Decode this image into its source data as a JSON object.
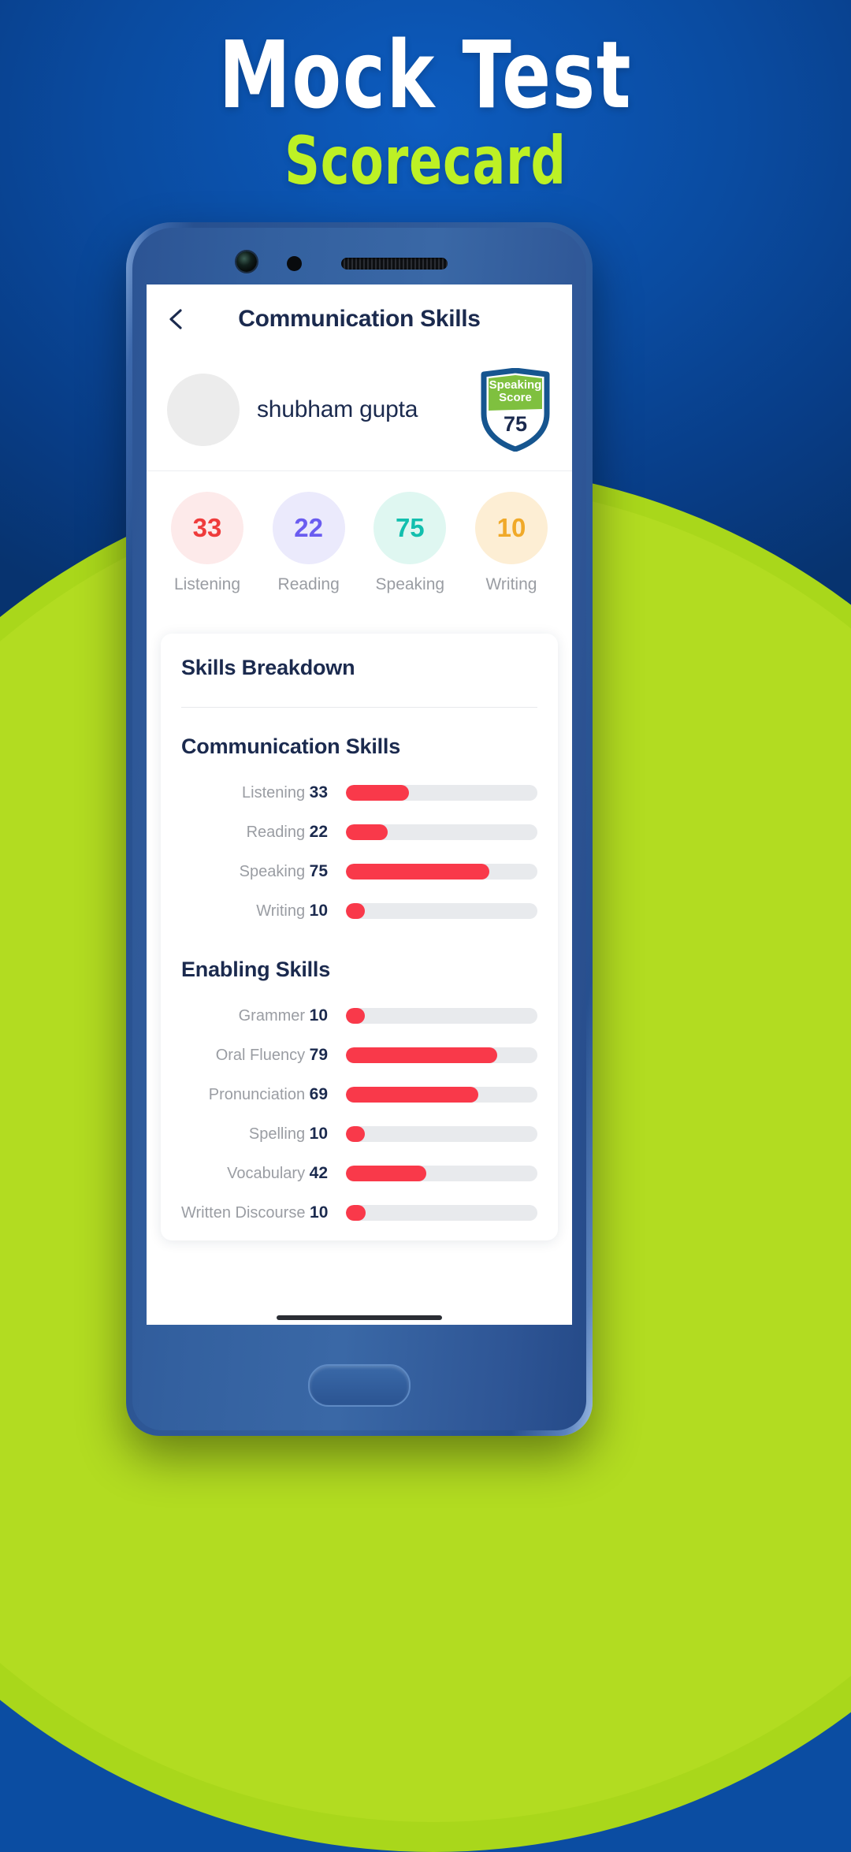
{
  "poster": {
    "title": "Mock Test",
    "subtitle": "Scorecard",
    "title_color": "#ffffff",
    "subtitle_color": "#bdf125",
    "bg_color": "#0a4ba0",
    "accent_green": "#b2dc21"
  },
  "appbar": {
    "back_icon": "chevron-left-icon",
    "title": "Communication Skills"
  },
  "profile": {
    "name": "shubham gupta",
    "avatar": "avatar-placeholder",
    "badge": {
      "label_line1": "Speaking",
      "label_line2": "Score",
      "score": "75",
      "shield_border": "#16558f",
      "shield_top": "#7fc03f",
      "shield_bottom": "#ffffff"
    }
  },
  "score_circles": [
    {
      "value": "33",
      "label": "Listening",
      "bg": "#fdeaea",
      "fg": "#ef3b3b"
    },
    {
      "value": "22",
      "label": "Reading",
      "bg": "#ebeafc",
      "fg": "#6a5cf0"
    },
    {
      "value": "75",
      "label": "Speaking",
      "bg": "#dff7f1",
      "fg": "#12bfae"
    },
    {
      "value": "10",
      "label": "Writing",
      "bg": "#fdeed4",
      "fg": "#f0a929"
    }
  ],
  "breakdown": {
    "card_title": "Skills Breakdown",
    "bar_color": "#f9394a",
    "track_color": "#e8eaed",
    "sections": [
      {
        "title": "Communication Skills",
        "rows": [
          {
            "label": "Listening",
            "value": "33"
          },
          {
            "label": "Reading",
            "value": "22"
          },
          {
            "label": "Speaking",
            "value": "75"
          },
          {
            "label": "Writing",
            "value": "10"
          }
        ]
      },
      {
        "title": "Enabling Skills",
        "rows": [
          {
            "label": "Grammer",
            "value": "10"
          },
          {
            "label": "Oral Fluency",
            "value": "79"
          },
          {
            "label": "Pronunciation",
            "value": "69"
          },
          {
            "label": "Spelling",
            "value": "10"
          },
          {
            "label": "Vocabulary",
            "value": "42"
          },
          {
            "label": "Written Discourse",
            "value": "10"
          }
        ]
      }
    ]
  },
  "chart_data": {
    "type": "bar",
    "title": "Skills Breakdown",
    "orientation": "horizontal",
    "xlim": [
      0,
      100
    ],
    "grid": false,
    "legend": "none",
    "series": [
      {
        "name": "Communication Skills",
        "categories": [
          "Listening",
          "Reading",
          "Speaking",
          "Writing"
        ],
        "values": [
          33,
          22,
          75,
          10
        ]
      },
      {
        "name": "Enabling Skills",
        "categories": [
          "Grammer",
          "Oral Fluency",
          "Pronunciation",
          "Spelling",
          "Vocabulary",
          "Written Discourse"
        ],
        "values": [
          10,
          79,
          69,
          10,
          42,
          10
        ]
      }
    ]
  }
}
